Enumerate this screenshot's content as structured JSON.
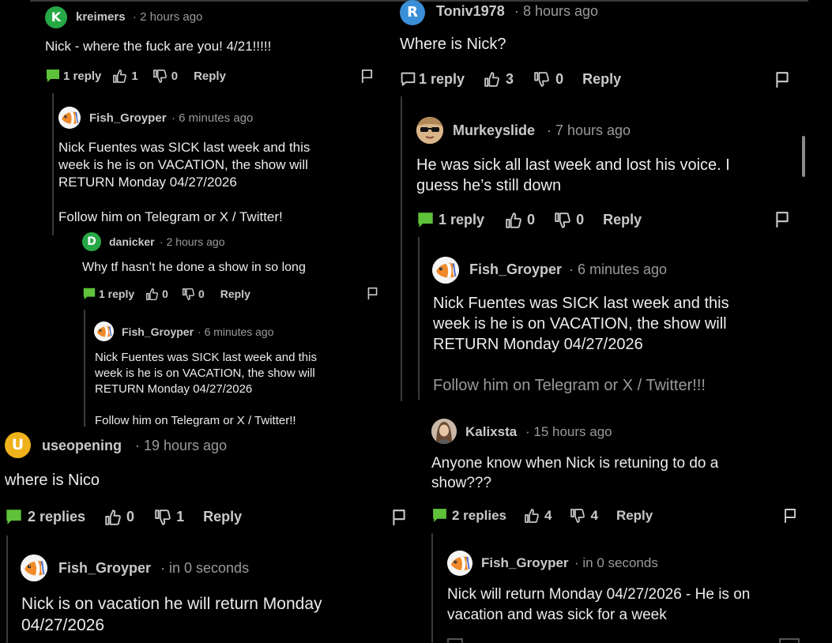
{
  "icons": {
    "reply": "chat-bubble-icon",
    "like": "thumbs-up-icon",
    "dislike": "thumbs-down-icon",
    "flag": "flag-icon"
  },
  "colors": {
    "green_reply": "#5fc23a",
    "avatar_k": "#27a846",
    "avatar_r": "#3a8fd8",
    "avatar_d": "#27a846",
    "avatar_u": "#f0b21a",
    "fish_orange": "#f08a2a",
    "fish_blue": "#4a6fd4"
  },
  "left": {
    "c1": {
      "initial": "K",
      "user": "kreimers",
      "time": "2 hours ago",
      "text": "Nick - where the fuck are you!  4/21!!!!!",
      "replies": "1 reply",
      "likes": "1",
      "dislikes": "0",
      "reply_label": "Reply"
    },
    "c1r": {
      "user": "Fish_Groyper",
      "time": "6 minutes ago",
      "line1": "Nick Fuentes was SICK last week and this",
      "line2": "week is he is on VACATION, the show will",
      "line3": "RETURN Monday 04/27/2026",
      "line4": "Follow him on Telegram or X / Twitter!"
    },
    "c2": {
      "initial": "D",
      "user": "danicker",
      "time": "2 hours ago",
      "text": "Why tf hasn’t he done a show in so long",
      "replies": "1 reply",
      "likes": "0",
      "dislikes": "0",
      "reply_label": "Reply"
    },
    "c2r": {
      "user": "Fish_Groyper",
      "time": "6 minutes ago",
      "line1": "Nick Fuentes was SICK last week and this",
      "line2": "week is he is on VACATION, the show will",
      "line3": "RETURN Monday 04/27/2026",
      "line4": "Follow him on Telegram or X / Twitter!!"
    },
    "c3": {
      "initial": "U",
      "user": "useopening",
      "time": "19 hours ago",
      "text": "where is Nico",
      "replies": "2 replies",
      "likes": "0",
      "dislikes": "1",
      "reply_label": "Reply"
    },
    "c3r": {
      "user": "Fish_Groyper",
      "time": "in 0 seconds",
      "line1": "Nick is on vacation he will return Monday",
      "line2": "04/27/2026"
    }
  },
  "right": {
    "c1": {
      "initial": "R",
      "user": "Toniv1978",
      "time": "8 hours ago",
      "text": "Where is Nick?",
      "replies": "1 reply",
      "likes": "3",
      "dislikes": "0",
      "reply_label": "Reply"
    },
    "c2": {
      "user": "Murkeyslide",
      "time": "7 hours ago",
      "line1": "He was sick all last week and lost his voice. I",
      "line2": "guess he’s still down",
      "replies": "1 reply",
      "likes": "0",
      "dislikes": "0",
      "reply_label": "Reply"
    },
    "c2r": {
      "user": "Fish_Groyper",
      "time": "6 minutes ago",
      "line1": "Nick Fuentes was SICK last week and this",
      "line2": "week is he is on VACATION, the show will",
      "line3": "RETURN Monday 04/27/2026",
      "line4": "Follow him on Telegram or X / Twitter!!!"
    },
    "c3": {
      "user": "Kalixsta",
      "time": "15 hours ago",
      "line1": "Anyone know when Nick is retuning to do a",
      "line2": "show???",
      "replies": "2 replies",
      "likes": "4",
      "dislikes": "4",
      "reply_label": "Reply"
    },
    "c3r": {
      "user": "Fish_Groyper",
      "time": "in 0 seconds",
      "line1": "Nick will return Monday 04/27/2026 - He is on",
      "line2": "vacation and was sick for a week"
    }
  }
}
